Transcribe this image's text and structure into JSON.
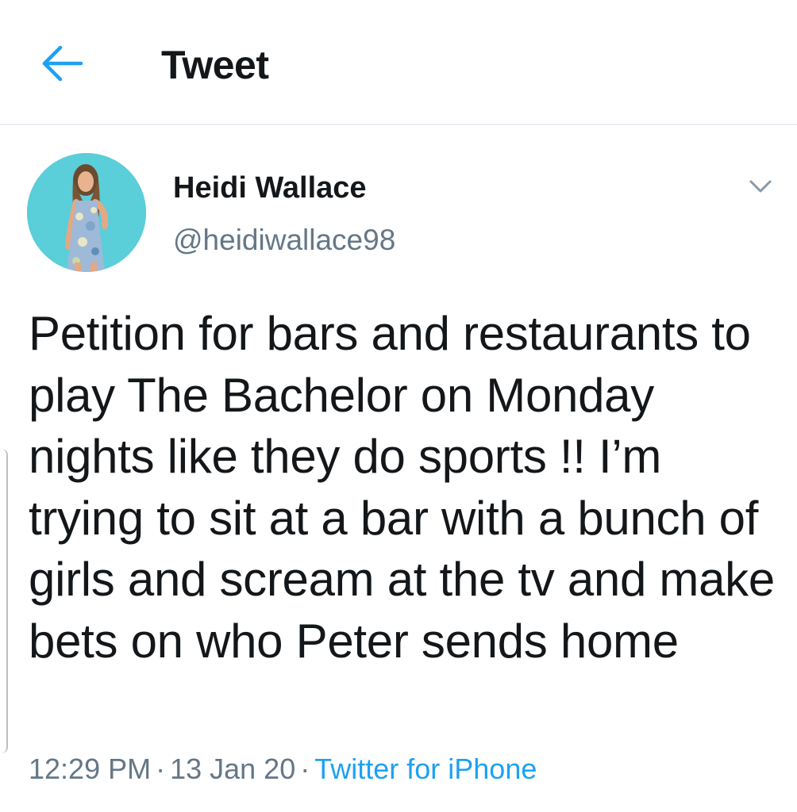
{
  "header": {
    "back_icon": "back-arrow-icon",
    "title": "Tweet"
  },
  "tweet": {
    "author": {
      "display_name": "Heidi Wallace",
      "handle": "@heidiwallace98",
      "avatar_bg": "#4fc9d6"
    },
    "menu_icon": "chevron-down-icon",
    "text": "Petition for bars and restaurants to play The Bachelor on Monday nights like they do sports !! I’m trying to sit at a bar with a bunch of girls and scream at the tv and make bets on who Peter sends home",
    "time": "12:29 PM",
    "separator": "·",
    "date": "13 Jan 20",
    "source": "Twitter for iPhone"
  },
  "colors": {
    "accent": "#1da1f2",
    "text_primary": "#14171a",
    "text_secondary": "#657786",
    "divider": "#e6ecf0"
  }
}
